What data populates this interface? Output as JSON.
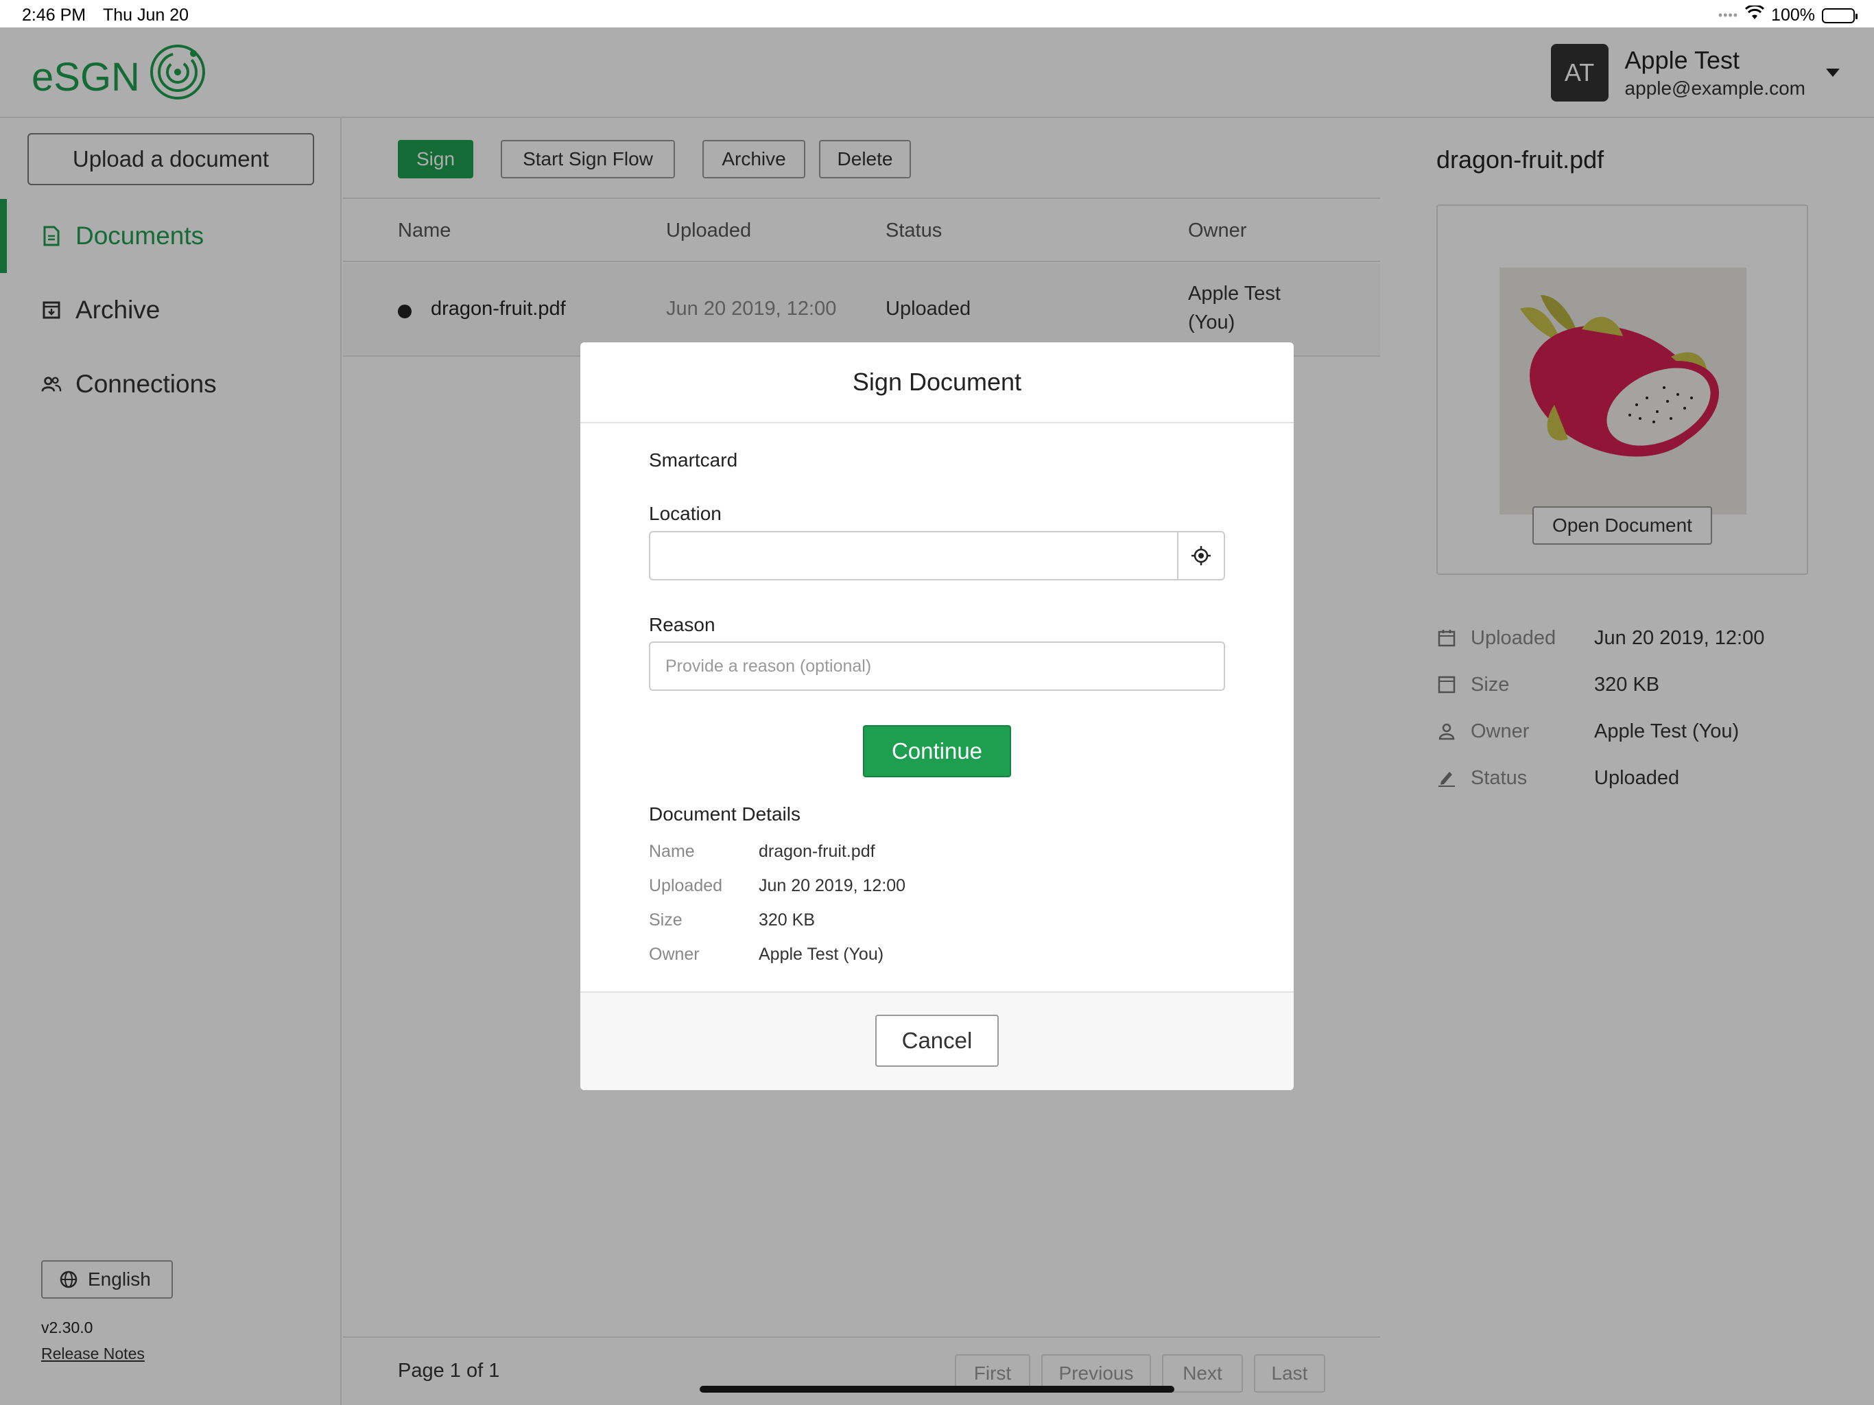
{
  "status_bar": {
    "time": "2:46 PM",
    "date": "Thu Jun 20",
    "battery": "100%"
  },
  "header": {
    "logo_text": "eSGN",
    "user": {
      "initials": "AT",
      "name": "Apple Test",
      "email": "apple@example.com"
    }
  },
  "sidebar": {
    "upload_label": "Upload a document",
    "items": [
      {
        "label": "Documents",
        "icon": "document-icon",
        "active": true
      },
      {
        "label": "Archive",
        "icon": "archive-icon",
        "active": false
      },
      {
        "label": "Connections",
        "icon": "people-icon",
        "active": false
      }
    ],
    "language": "English",
    "version": "v2.30.0",
    "release_notes": "Release Notes"
  },
  "toolbar": {
    "sign": "Sign",
    "start_sign_flow": "Start Sign Flow",
    "archive": "Archive",
    "delete": "Delete"
  },
  "table": {
    "columns": [
      "Name",
      "Uploaded",
      "Status",
      "Owner"
    ],
    "rows": [
      {
        "name": "dragon-fruit.pdf",
        "uploaded": "Jun 20 2019, 12:00",
        "status": "Uploaded",
        "owner_line1": "Apple Test",
        "owner_line2": "(You)"
      }
    ]
  },
  "pager": {
    "info": "Page 1 of 1",
    "first": "First",
    "previous": "Previous",
    "next": "Next",
    "last": "Last"
  },
  "details_panel": {
    "title": "dragon-fruit.pdf",
    "open_document": "Open Document",
    "meta": [
      {
        "label": "Uploaded",
        "value": "Jun 20 2019, 12:00",
        "icon": "calendar-icon"
      },
      {
        "label": "Size",
        "value": "320 KB",
        "icon": "size-icon"
      },
      {
        "label": "Owner",
        "value": "Apple Test (You)",
        "icon": "person-icon"
      },
      {
        "label": "Status",
        "value": "Uploaded",
        "icon": "pen-icon"
      }
    ]
  },
  "modal": {
    "title": "Sign Document",
    "method": "Smartcard",
    "location_label": "Location",
    "location_value": "",
    "reason_label": "Reason",
    "reason_placeholder": "Provide a reason (optional)",
    "continue": "Continue",
    "details_title": "Document Details",
    "details": [
      {
        "k": "Name",
        "v": "dragon-fruit.pdf"
      },
      {
        "k": "Uploaded",
        "v": "Jun 20 2019, 12:00"
      },
      {
        "k": "Size",
        "v": "320 KB"
      },
      {
        "k": "Owner",
        "v": "Apple Test (You)"
      }
    ],
    "cancel": "Cancel"
  },
  "colors": {
    "accent": "#1e9e4f",
    "overlay": "rgba(0,0,0,0.32)"
  }
}
